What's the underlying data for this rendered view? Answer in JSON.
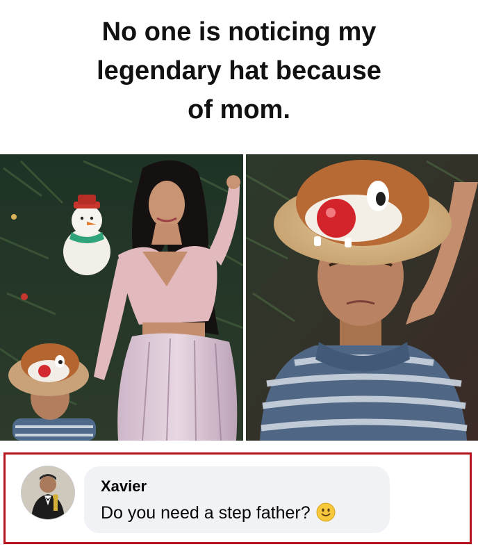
{
  "caption": {
    "line1": "No one is noticing my",
    "line2": "legendary hat because",
    "line3": "of mom."
  },
  "photos": {
    "left": {
      "subject": "woman-and-boy-with-chipmunk-hat"
    },
    "right": {
      "subject": "boy-with-chipmunk-hat-closeup"
    }
  },
  "comment": {
    "author": "Xavier",
    "text": "Do you need a step father?",
    "emoji": "smiling-face-icon",
    "frame_color": "#b5121b",
    "bubble_color": "#f0f2f5"
  }
}
